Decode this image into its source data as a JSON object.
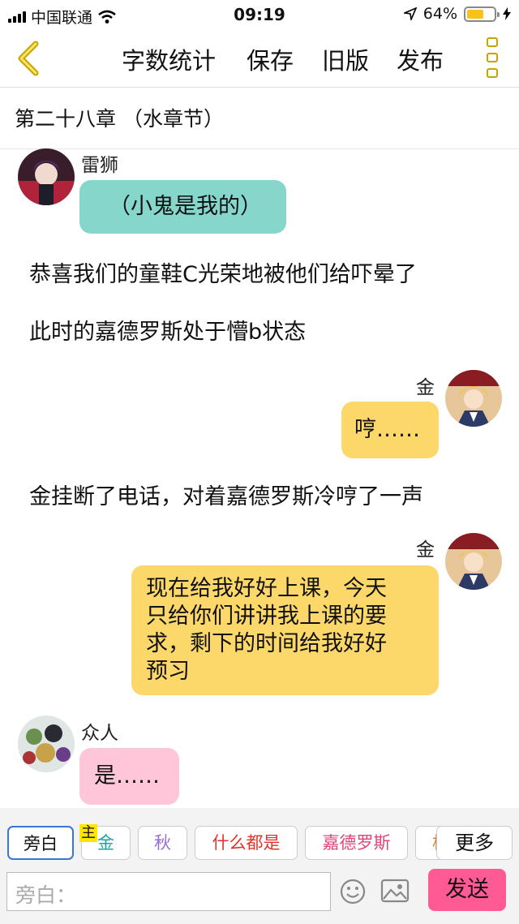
{
  "status_bar": {
    "carrier": "中国联通",
    "time": "09:19",
    "battery": "64%",
    "battery_level": 0.64
  },
  "toolbar": {
    "word_count": "字数统计",
    "save": "保存",
    "old_version": "旧版",
    "publish": "发布"
  },
  "chapter_title": "第二十八章 （水章节）",
  "messages": [
    {
      "speaker": "雷狮",
      "text": "（小鬼是我的）"
    },
    {
      "narration": "恭喜我们的童鞋C光荣地被他们给吓晕了"
    },
    {
      "narration": "此时的嘉德罗斯处于懵b状态"
    },
    {
      "speaker": "金",
      "text": "哼……"
    },
    {
      "narration": "金挂断了电话，对着嘉德罗斯冷哼了一声"
    },
    {
      "speaker": "金",
      "lines": [
        "现在给我好好上课，今天",
        "只给你们讲讲我上课的要",
        "求，剩下的时间给我好好",
        "预习"
      ]
    },
    {
      "speaker": "众人",
      "text": "是……"
    }
  ],
  "roles": [
    {
      "label": "旁白"
    },
    {
      "label": "金",
      "tag": "主"
    },
    {
      "label": "秋"
    },
    {
      "label": "什么都是"
    },
    {
      "label": "嘉德罗斯"
    },
    {
      "label": "格"
    }
  ],
  "more": "更多",
  "input": {
    "placeholder": "旁白："
  },
  "send": "发送",
  "colors": {
    "teal_bubble": "#86d6cc",
    "yellow_bubble": "#fcd86a",
    "pink_bubble": "#ffc6d9",
    "send_button": "#ff5a93",
    "accent_yellow": "#f6c21b"
  }
}
